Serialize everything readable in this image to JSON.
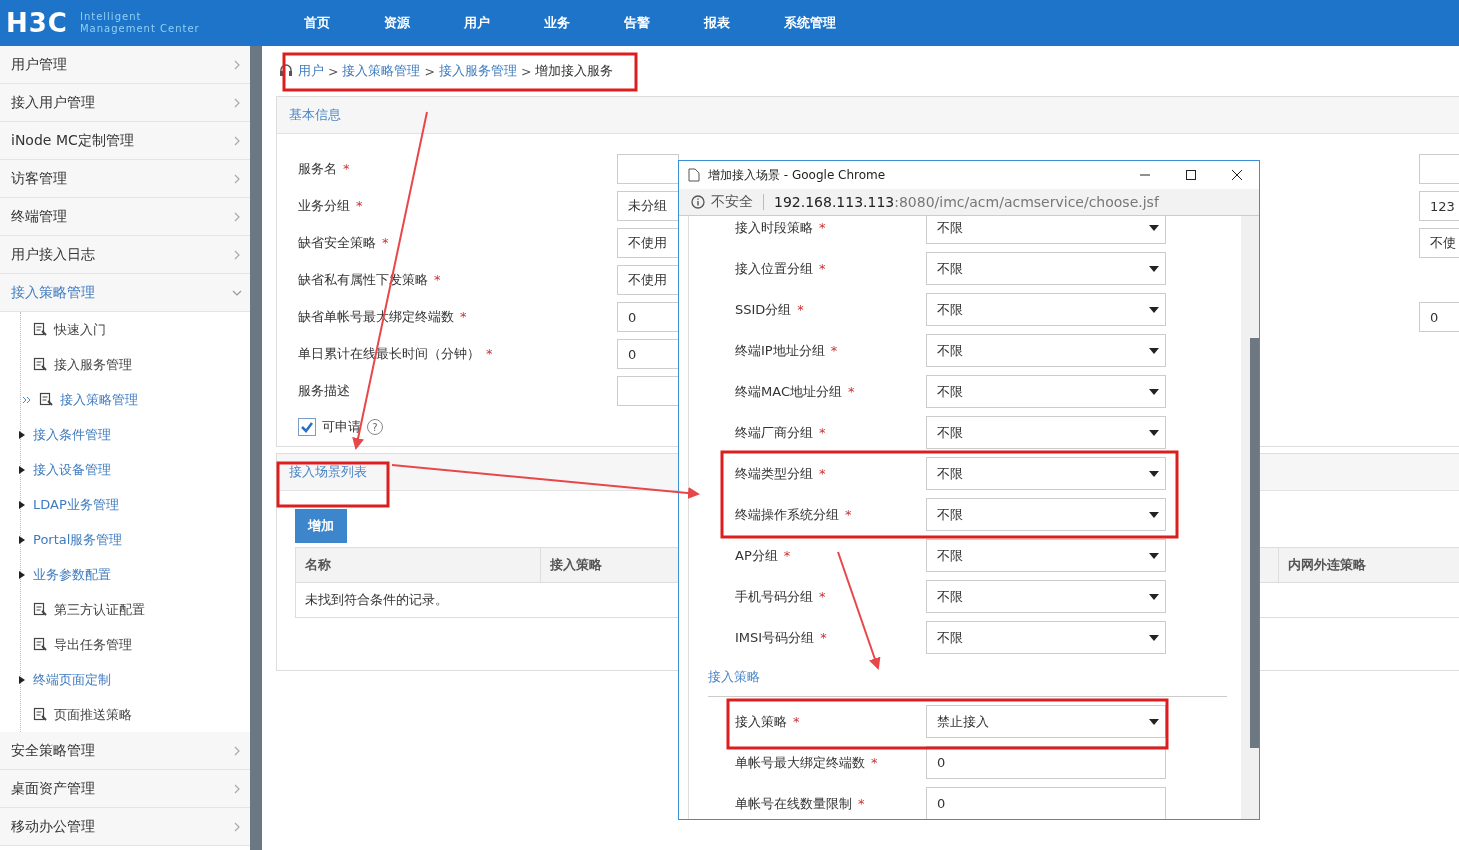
{
  "required_mark": "*",
  "header": {
    "logo": "H3C",
    "tagline_1": "Intelligent",
    "tagline_2": "Management Center",
    "nav": [
      "首页",
      "资源",
      "用户",
      "业务",
      "告警",
      "报表",
      "系统管理"
    ]
  },
  "sidebar": {
    "items": [
      {
        "label": "用户管理",
        "expanded": false
      },
      {
        "label": "接入用户管理",
        "expanded": false
      },
      {
        "label": "iNode MC定制管理",
        "expanded": false
      },
      {
        "label": "访客管理",
        "expanded": false
      },
      {
        "label": "终端管理",
        "expanded": false
      },
      {
        "label": "用户接入日志",
        "expanded": false
      },
      {
        "label": "接入策略管理",
        "expanded": true,
        "children": [
          {
            "label": "快速入门",
            "kind": "leaf",
            "selected": false
          },
          {
            "label": "接入服务管理",
            "kind": "leaf",
            "selected": false
          },
          {
            "label": "接入策略管理",
            "kind": "leaf",
            "selected": true
          },
          {
            "label": "接入条件管理",
            "kind": "group",
            "selected": false
          },
          {
            "label": "接入设备管理",
            "kind": "group",
            "selected": false
          },
          {
            "label": "LDAP业务管理",
            "kind": "group",
            "selected": false
          },
          {
            "label": "Portal服务管理",
            "kind": "group",
            "selected": false
          },
          {
            "label": "业务参数配置",
            "kind": "group",
            "selected": false
          },
          {
            "label": "第三方认证配置",
            "kind": "leaf",
            "selected": false
          },
          {
            "label": "导出任务管理",
            "kind": "leaf",
            "selected": false
          },
          {
            "label": "终端页面定制",
            "kind": "group",
            "selected": false
          },
          {
            "label": "页面推送策略",
            "kind": "leaf",
            "selected": false
          }
        ]
      },
      {
        "label": "安全策略管理",
        "expanded": false
      },
      {
        "label": "桌面资产管理",
        "expanded": false
      },
      {
        "label": "移动办公管理",
        "expanded": false
      }
    ]
  },
  "breadcrumb": {
    "separator": ">",
    "items": [
      {
        "label": "用户",
        "link": true
      },
      {
        "label": "接入策略管理",
        "link": true
      },
      {
        "label": "接入服务管理",
        "link": true
      },
      {
        "label": "增加接入服务",
        "link": false
      }
    ]
  },
  "basic_info": {
    "title": "基本信息",
    "fields": [
      {
        "label": "服务名",
        "required": true,
        "right_field": true
      },
      {
        "label": "业务分组",
        "required": true,
        "value": "未分组",
        "right_field": true,
        "right_value": "123"
      },
      {
        "label": "缺省安全策略",
        "required": true,
        "value": "不使用",
        "right_field": true,
        "right_value": "不使"
      },
      {
        "label": "缺省私有属性下发策略",
        "required": true,
        "value": "不使用",
        "right_field": false
      },
      {
        "label": "缺省单帐号最大绑定终端数",
        "required": true,
        "value": "0",
        "right_field": true,
        "right_value": "0"
      },
      {
        "label": "单日累计在线最长时间（分钟）",
        "required": true,
        "value": "0",
        "right_field": false
      },
      {
        "label": "服务描述",
        "required": false,
        "right_field": false
      }
    ],
    "applicable": {
      "label": "可申请",
      "checked": true,
      "help": "?"
    }
  },
  "scenario_list": {
    "title": "接入场景列表",
    "add_button": "增加",
    "columns": [
      "名称",
      "接入策略",
      "内网外连策略"
    ],
    "empty_message": "未找到符合条件的记录。"
  },
  "popup": {
    "title": "增加接入场景 - Google Chrome",
    "security": "不安全",
    "url_host": "192.168.113.113",
    "url_path": ":8080/imc/acm/acmservice/choose.jsf",
    "fields": [
      {
        "label": "接入时段策略",
        "kind": "select",
        "required": true,
        "value": "不限"
      },
      {
        "label": "接入位置分组",
        "kind": "select",
        "required": true,
        "value": "不限"
      },
      {
        "label": "SSID分组",
        "kind": "select",
        "required": true,
        "value": "不限"
      },
      {
        "label": "终端IP地址分组",
        "kind": "select",
        "required": true,
        "value": "不限"
      },
      {
        "label": "终端MAC地址分组",
        "kind": "select",
        "required": true,
        "value": "不限"
      },
      {
        "label": "终端厂商分组",
        "kind": "select",
        "required": true,
        "value": "不限"
      },
      {
        "label": "终端类型分组",
        "kind": "select",
        "required": true,
        "value": "不限"
      },
      {
        "label": "终端操作系统分组",
        "kind": "select",
        "required": true,
        "value": "不限"
      },
      {
        "label": "AP分组",
        "kind": "select",
        "required": true,
        "value": "不限"
      },
      {
        "label": "手机号码分组",
        "kind": "select",
        "required": true,
        "value": "不限"
      },
      {
        "label": "IMSI号码分组",
        "kind": "select",
        "required": true,
        "value": "不限"
      }
    ],
    "section": "接入策略",
    "policy_fields": [
      {
        "label": "接入策略",
        "kind": "select",
        "required": true,
        "value": "禁止接入"
      },
      {
        "label": "单帐号最大绑定终端数",
        "kind": "input",
        "required": true,
        "value": "0"
      },
      {
        "label": "单帐号在线数量限制",
        "kind": "input",
        "required": true,
        "value": "0"
      }
    ]
  }
}
